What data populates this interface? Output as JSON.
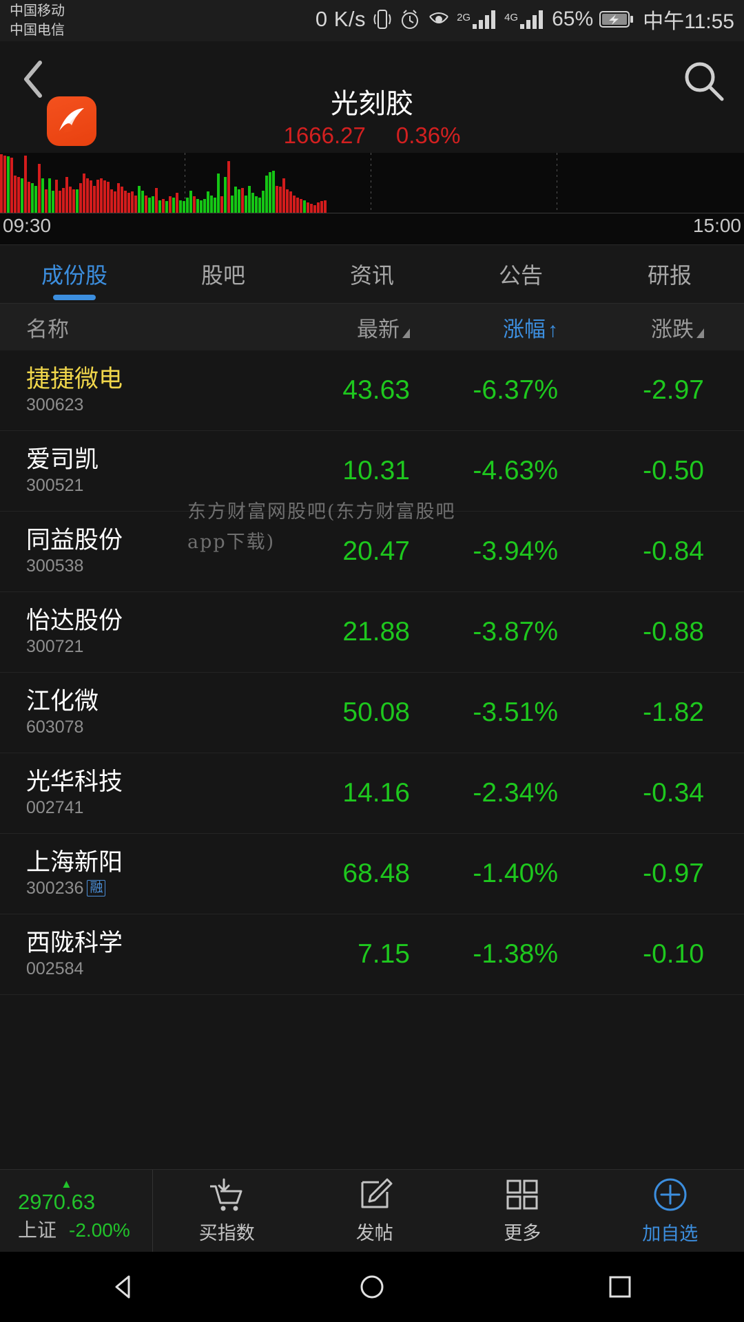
{
  "status": {
    "carrier1": "中国移动",
    "carrier2": "中国电信",
    "net_speed": "0 K/s",
    "signal1_label": "2G",
    "signal2_label": "4G",
    "battery": "65%",
    "time": "中午11:55",
    "icons": [
      "vibrate-icon",
      "alarm-clock-icon",
      "eye-care-icon",
      "signal-2g-icon",
      "signal-4g-icon",
      "battery-charging-icon"
    ]
  },
  "header": {
    "back": "back-icon",
    "logo": "eastmoney-logo",
    "title": "光刻胶",
    "price": "1666.27",
    "change_pct": "0.36%",
    "search": "search-icon",
    "up_color": "#d32020"
  },
  "chart": {
    "time_start": "09:30",
    "time_end": "15:00",
    "up_color": "#d31c1c",
    "down_color": "#15c615"
  },
  "tabs": [
    {
      "label": "成份股",
      "active": true
    },
    {
      "label": "股吧",
      "active": false
    },
    {
      "label": "资讯",
      "active": false
    },
    {
      "label": "公告",
      "active": false
    },
    {
      "label": "研报",
      "active": false
    }
  ],
  "columns": {
    "name": "名称",
    "latest": "最新",
    "pct": "涨幅",
    "pct_arrow": "↑",
    "change": "涨跌"
  },
  "rows": [
    {
      "name": "捷捷微电",
      "code": "300623",
      "highlight": true,
      "badge": "",
      "latest": "43.63",
      "pct": "-6.37%",
      "change": "-2.97"
    },
    {
      "name": "爱司凯",
      "code": "300521",
      "highlight": false,
      "badge": "",
      "latest": "10.31",
      "pct": "-4.63%",
      "change": "-0.50"
    },
    {
      "name": "同益股份",
      "code": "300538",
      "highlight": false,
      "badge": "",
      "latest": "20.47",
      "pct": "-3.94%",
      "change": "-0.84"
    },
    {
      "name": "怡达股份",
      "code": "300721",
      "highlight": false,
      "badge": "",
      "latest": "21.88",
      "pct": "-3.87%",
      "change": "-0.88"
    },
    {
      "name": "江化微",
      "code": "603078",
      "highlight": false,
      "badge": "",
      "latest": "50.08",
      "pct": "-3.51%",
      "change": "-1.82"
    },
    {
      "name": "光华科技",
      "code": "002741",
      "highlight": false,
      "badge": "",
      "latest": "14.16",
      "pct": "-2.34%",
      "change": "-0.34"
    },
    {
      "name": "上海新阳",
      "code": "300236",
      "highlight": false,
      "badge": "融",
      "latest": "68.48",
      "pct": "-1.40%",
      "change": "-0.97"
    },
    {
      "name": "西陇科学",
      "code": "002584",
      "highlight": false,
      "badge": "",
      "latest": "7.15",
      "pct": "-1.38%",
      "change": "-0.10"
    }
  ],
  "down_color": "#1ec81e",
  "watermark": "东方财富网股吧(东方财富股吧app下载)",
  "bottombar": {
    "index_value": "2970.63",
    "index_name": "上证",
    "index_pct": "-2.00%",
    "items": [
      {
        "label": "买指数",
        "icon": "cart-index-icon",
        "accent": false
      },
      {
        "label": "发帖",
        "icon": "compose-icon",
        "accent": false
      },
      {
        "label": "更多",
        "icon": "grid-more-icon",
        "accent": false
      },
      {
        "label": "加自选",
        "icon": "plus-circle-icon",
        "accent": true
      }
    ]
  },
  "navbar": {
    "back": "nav-back-triangle-icon",
    "home": "nav-home-circle-icon",
    "recents": "nav-recents-square-icon"
  }
}
